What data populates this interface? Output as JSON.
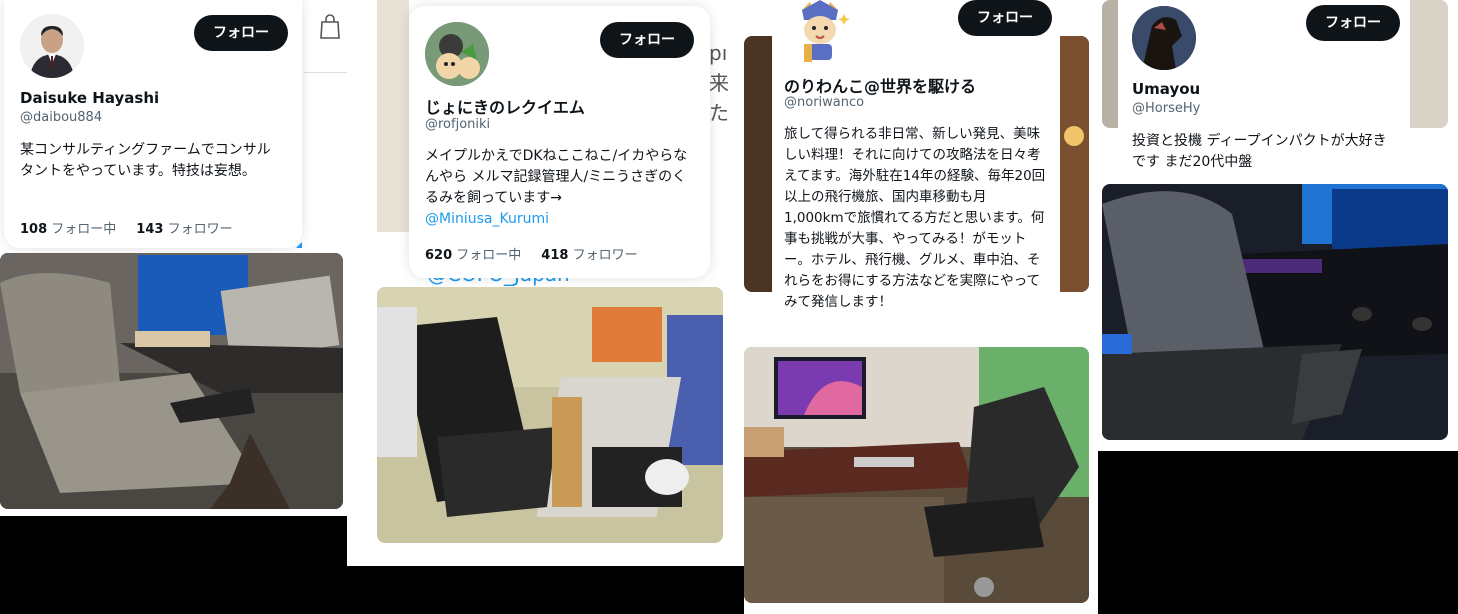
{
  "cards": [
    {
      "name": "Daisuke Hayashi",
      "handle": "@daibou884",
      "bio": "某コンサルティングファームでコンサルタントをやっています。特技は妄想。",
      "following_count": "108",
      "following_label": "フォロー中",
      "followers_count": "143",
      "followers_label": "フォロワー",
      "follow_label": "フォロー"
    },
    {
      "name": "じょにきのレクイエム",
      "handle": "@rofjoniki",
      "bio": "メイプルかえでDKねここねこ/イカやらなんやら メルマ記録管理人/ミニうさぎのくるみを飼っています→",
      "bio_link": "@Miniusa_Kurumi",
      "following_count": "620",
      "following_label": "フォロー中",
      "followers_count": "418",
      "followers_label": "フォロワー",
      "follow_label": "フォロー"
    },
    {
      "name": "のりわんこ@世界を駆ける",
      "handle": "@noriwanco",
      "bio": "旅して得られる非日常、新しい発見、美味しい料理！それに向けての攻略法を日々考えてます。海外駐在14年の経験、毎年20回以上の飛行機旅、国内車移動も月1,000kmで旅慣れてる方だと思います。何事も挑戦が大事、やってみる！がモットー。ホテル、飛行機、グルメ、車中泊、それらをお得にする方法などを実際にやってみて発信します！",
      "follow_label": "フォロー"
    },
    {
      "name": "Umayou",
      "handle": "@HorseHy",
      "bio": "投資と投機 ディープインパクトが大好きです まだ20代中盤",
      "follow_label": "フォロー"
    }
  ],
  "background_text": {
    "col2_partial_handle": "@COFO_Japan"
  },
  "icons": [
    "shopping-bag-icon"
  ],
  "colors": {
    "follow_button_bg": "#0f1419",
    "link": "#1d9bf0",
    "secondary_text": "#536471"
  }
}
